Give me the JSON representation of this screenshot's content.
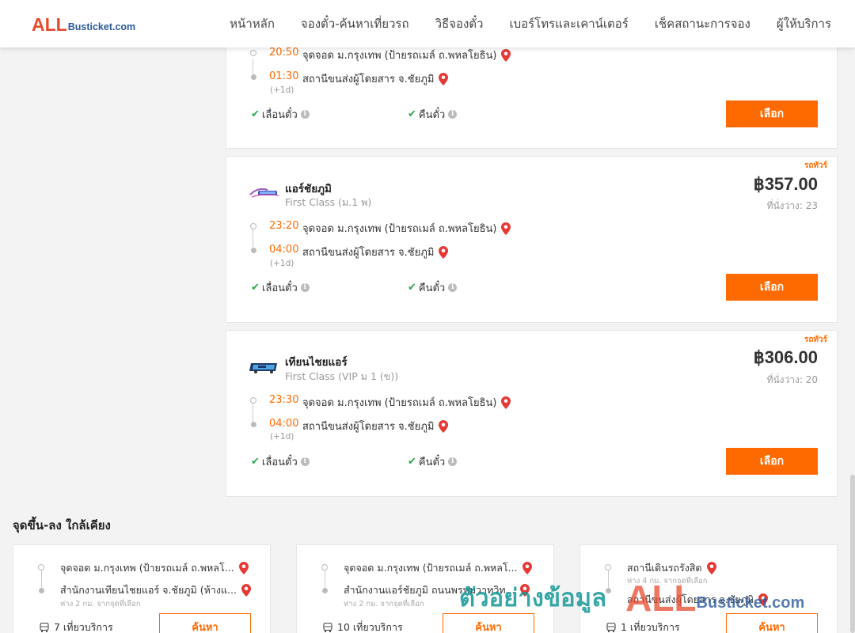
{
  "brand": {
    "logo_prefix": "ALL",
    "logo_suffix": "Busticket.com"
  },
  "nav": {
    "home": "หน้าหลัก",
    "book": "จองตั๋ว-ค้นหาเที่ยวรถ",
    "how_to": "วิธีจองตั๋ว",
    "contact": "เบอร์โทรและเคาน์เตอร์",
    "check_status": "เช็คสถานะการจอง",
    "providers": "ผู้ให้บริการ"
  },
  "results": [
    {
      "dep_time": "20:50",
      "dep_stop": "จุดจอด ม.กรุงเทพ (ป้ายรถเมล์ ถ.พหลโยธิน)",
      "arr_time": "01:30",
      "arr_stop": "สถานีขนส่งผู้โดยสาร จ.ชัยภูมิ",
      "next_day": "(+1d)",
      "feature_change": "เลื่อนตั๋ว",
      "feature_refund": "คืนตั๋ว",
      "select_label": "เลือก"
    },
    {
      "tag": "รถทัวร์",
      "operator": "แอร์ชัยภูมิ",
      "class": "First Class (ม.1 พ)",
      "price": "฿357.00",
      "seats": "ที่นั่งว่าง: 23",
      "dep_time": "23:20",
      "dep_stop": "จุดจอด ม.กรุงเทพ (ป้ายรถเมล์ ถ.พหลโยธิน)",
      "arr_time": "04:00",
      "arr_stop": "สถานีขนส่งผู้โดยสาร จ.ชัยภูมิ",
      "next_day": "(+1d)",
      "feature_change": "เลื่อนตั๋ว",
      "feature_refund": "คืนตั๋ว",
      "select_label": "เลือก"
    },
    {
      "tag": "รถทัวร์",
      "operator": "เทียนไชยแอร์",
      "class": "First Class (VIP ม 1 (ข))",
      "price": "฿306.00",
      "seats": "ที่นั่งว่าง: 20",
      "dep_time": "23:30",
      "dep_stop": "จุดจอด ม.กรุงเทพ (ป้ายรถเมล์ ถ.พหลโยธิน)",
      "arr_time": "04:00",
      "arr_stop": "สถานีขนส่งผู้โดยสาร จ.ชัยภูมิ",
      "next_day": "(+1d)",
      "feature_change": "เลื่อนตั๋ว",
      "feature_refund": "คืนตั๋ว",
      "select_label": "เลือก"
    }
  ],
  "nearby": {
    "title": "จุดขึ้น-ลง ใกล้เคียง",
    "items": [
      {
        "from": "จุดจอด ม.กรุงเทพ (ป้ายรถเมล์ ถ.พหลโ...",
        "to": "สำนักงานเทียนไชยแอร์ จ.ชัยภูมิ (ห้างแ...",
        "distance": "ห่าง 2 กม. จากจุดที่เลือก",
        "trips": "7 เที่ยวบริการ",
        "button": "ค้นหา"
      },
      {
        "from": "จุดจอด ม.กรุงเทพ (ป้ายรถเมล์ ถ.พหลโ...",
        "to": "สำนักงานแอร์ชัยภูมิ ถนนพรหมวาทวิท...",
        "distance": "ห่าง 2 กม. จากจุดที่เลือก",
        "trips": "10 เที่ยวบริการ",
        "button": "ค้นหา"
      },
      {
        "from": "สถานีเดินรถรังสิต",
        "from_distance": "ห่าง 4 กม. จากจุดที่เลือก",
        "to": "สถานีขนส่งผู้โดยสาร จ.ชัยภูมิ",
        "trips": "1 เที่ยวบริการ",
        "button": "ค้นหา"
      }
    ]
  },
  "watermark": {
    "text": "ตัวอย่างข้อมูล",
    "logo_prefix": "ALL",
    "logo_suffix": "Busticket.com"
  },
  "colors": {
    "accent": "#ff6a00",
    "check": "#2ba84a",
    "pin": "#e53935",
    "brand_red": "#e84a2c",
    "brand_blue": "#2b5a9c"
  }
}
